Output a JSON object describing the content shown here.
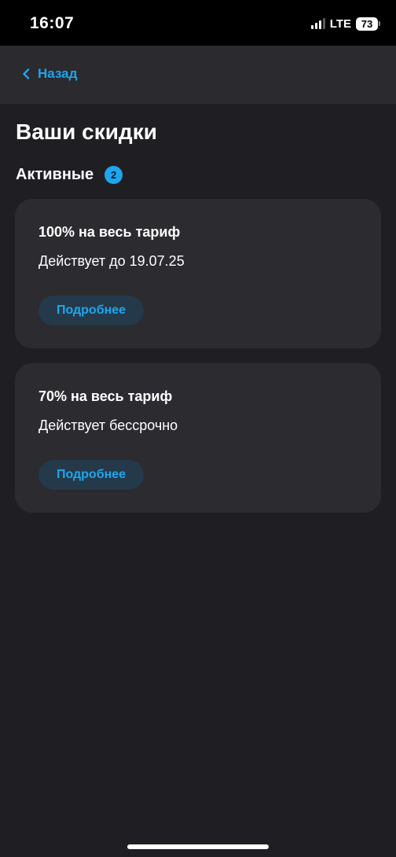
{
  "status_bar": {
    "time": "16:07",
    "network": "LTE",
    "battery": "73"
  },
  "nav": {
    "back_label": "Назад",
    "back_icon": "chevron-left-icon"
  },
  "page": {
    "title": "Ваши скидки"
  },
  "section": {
    "title": "Активные",
    "count": "2"
  },
  "discounts": [
    {
      "title": "100% на весь тариф",
      "subtitle": "Действует до 19.07.25",
      "button_label": "Подробнее"
    },
    {
      "title": "70% на весь тариф",
      "subtitle": "Действует бессрочно",
      "button_label": "Подробнее"
    }
  ],
  "colors": {
    "accent": "#1da6ee",
    "background": "#1f1f23",
    "card": "#2b2b30",
    "nav": "#2a2a2f"
  }
}
